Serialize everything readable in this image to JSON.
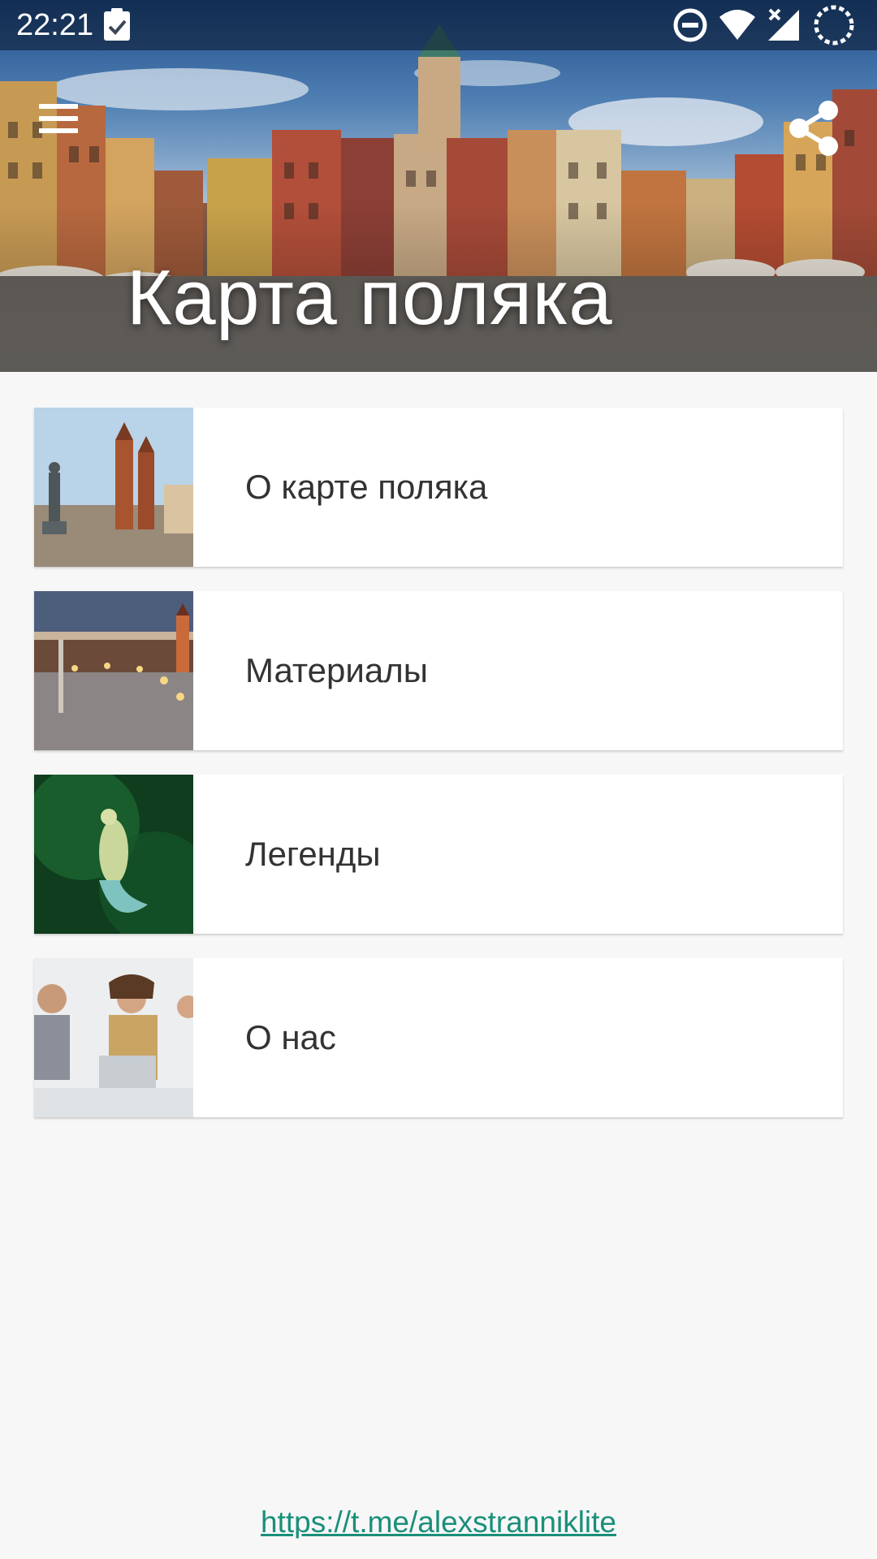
{
  "status_bar": {
    "time": "22:21",
    "icons": [
      "clipboard-check-icon",
      "do-not-disturb-icon",
      "wifi-icon",
      "signal-off-icon",
      "loading-icon"
    ]
  },
  "header": {
    "title": "Карта поляка",
    "menu_icon": "hamburger-menu-icon",
    "share_icon": "share-icon"
  },
  "menu": {
    "items": [
      {
        "label": "О карте поляка",
        "image": "krakow-market-square"
      },
      {
        "label": "Материалы",
        "image": "warsaw-old-town-evening"
      },
      {
        "label": "Легенды",
        "image": "mermaid-green-forest"
      },
      {
        "label": "О нас",
        "image": "business-team-meeting"
      }
    ]
  },
  "footer": {
    "link": "https://t.me/alexstranniklite"
  },
  "colors": {
    "background": "#f7f7f7",
    "card": "#ffffff",
    "link": "#1a8f7a",
    "text": "#333333"
  }
}
